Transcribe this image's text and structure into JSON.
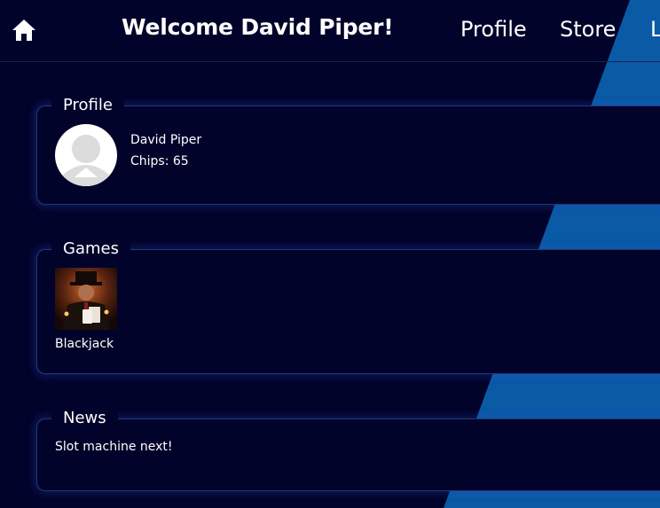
{
  "header": {
    "welcome": "Welcome David Piper!",
    "nav": [
      "Profile",
      "Store",
      "L"
    ]
  },
  "profile": {
    "legend": "Profile",
    "name": "David Piper",
    "chips": "Chips: 65"
  },
  "games": {
    "legend": "Games",
    "items": [
      {
        "label": "Blackjack"
      }
    ]
  },
  "news": {
    "legend": "News",
    "text": "Slot machine next!"
  },
  "colors": {
    "background": "#02032a",
    "accent_stripe": "#0a5aa6",
    "card_border": "#1e3a78"
  }
}
